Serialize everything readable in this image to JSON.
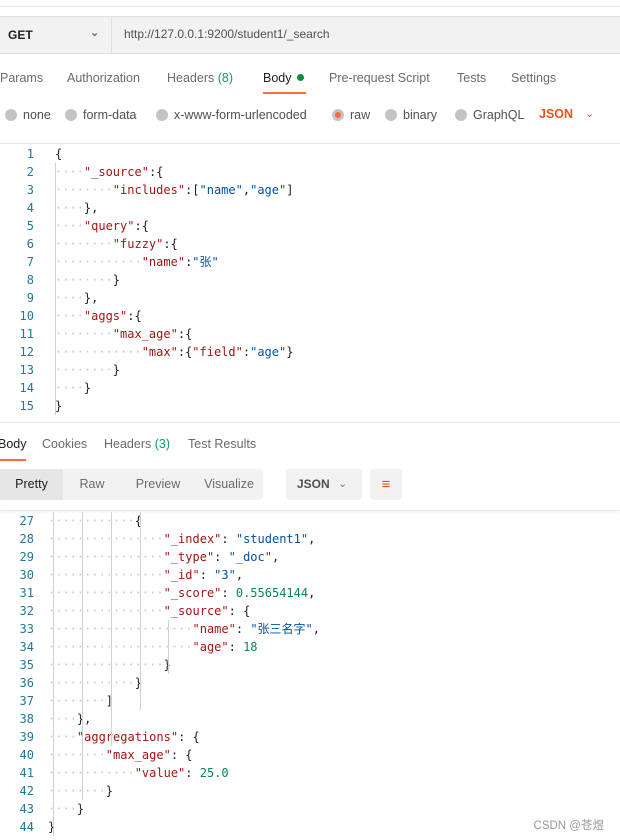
{
  "request": {
    "method": "GET",
    "url": "http://127.0.0.1:9200/student1/_search",
    "tabs": [
      {
        "label": "Params"
      },
      {
        "label": "Authorization"
      },
      {
        "label": "Headers",
        "count": "(8)"
      },
      {
        "label": "Body",
        "active": true
      },
      {
        "label": "Pre-request Script"
      },
      {
        "label": "Tests"
      },
      {
        "label": "Settings"
      }
    ],
    "body_types": [
      {
        "label": "none"
      },
      {
        "label": "form-data"
      },
      {
        "label": "x-www-form-urlencoded"
      },
      {
        "label": "raw",
        "selected": true
      },
      {
        "label": "binary"
      },
      {
        "label": "GraphQL"
      }
    ],
    "raw_format": "JSON",
    "code": [
      {
        "n": "1",
        "i": 0,
        "t": [
          [
            "p",
            "{"
          ]
        ]
      },
      {
        "n": "2",
        "i": 1,
        "t": [
          [
            "k",
            "\"_source\""
          ],
          [
            "p",
            ":{"
          ]
        ]
      },
      {
        "n": "3",
        "i": 2,
        "t": [
          [
            "k",
            "\"includes\""
          ],
          [
            "p",
            ":["
          ],
          [
            "s",
            "\"name\""
          ],
          [
            "p",
            ","
          ],
          [
            "s",
            "\"age\""
          ],
          [
            "p",
            "]"
          ]
        ]
      },
      {
        "n": "4",
        "i": 1,
        "t": [
          [
            "p",
            "},"
          ]
        ]
      },
      {
        "n": "5",
        "i": 1,
        "t": [
          [
            "k",
            "\"query\""
          ],
          [
            "p",
            ":{"
          ]
        ]
      },
      {
        "n": "6",
        "i": 2,
        "t": [
          [
            "k",
            "\"fuzzy\""
          ],
          [
            "p",
            ":{"
          ]
        ]
      },
      {
        "n": "7",
        "i": 3,
        "t": [
          [
            "k",
            "\"name\""
          ],
          [
            "p",
            ":"
          ],
          [
            "s",
            "\"张\""
          ]
        ]
      },
      {
        "n": "8",
        "i": 2,
        "t": [
          [
            "p",
            "}"
          ]
        ]
      },
      {
        "n": "9",
        "i": 1,
        "t": [
          [
            "p",
            "},"
          ]
        ]
      },
      {
        "n": "10",
        "i": 1,
        "t": [
          [
            "k",
            "\"aggs\""
          ],
          [
            "p",
            ":{"
          ]
        ]
      },
      {
        "n": "11",
        "i": 2,
        "t": [
          [
            "k",
            "\"max_age\""
          ],
          [
            "p",
            ":{"
          ]
        ]
      },
      {
        "n": "12",
        "i": 3,
        "t": [
          [
            "k",
            "\"max\""
          ],
          [
            "p",
            ":{"
          ],
          [
            "k",
            "\"field\""
          ],
          [
            "p",
            ":"
          ],
          [
            "s",
            "\"age\""
          ],
          [
            "p",
            "}"
          ]
        ]
      },
      {
        "n": "13",
        "i": 2,
        "t": [
          [
            "p",
            "}"
          ]
        ]
      },
      {
        "n": "14",
        "i": 1,
        "t": [
          [
            "p",
            "}"
          ]
        ]
      },
      {
        "n": "15",
        "i": 0,
        "t": [
          [
            "p",
            "}"
          ]
        ]
      }
    ]
  },
  "response": {
    "tabs": [
      {
        "label": "Body",
        "active": true
      },
      {
        "label": "Cookies"
      },
      {
        "label": "Headers",
        "count": "(3)"
      },
      {
        "label": "Test Results"
      }
    ],
    "views": [
      "Pretty",
      "Raw",
      "Preview",
      "Visualize"
    ],
    "format": "JSON",
    "wrap_icon": "wrap-lines-icon",
    "code": [
      {
        "n": "27",
        "i": 3,
        "t": [
          [
            "p",
            "{"
          ]
        ]
      },
      {
        "n": "28",
        "i": 4,
        "t": [
          [
            "k",
            "\"_index\""
          ],
          [
            "p",
            ": "
          ],
          [
            "s",
            "\"student1\""
          ],
          [
            "p",
            ","
          ]
        ]
      },
      {
        "n": "29",
        "i": 4,
        "t": [
          [
            "k",
            "\"_type\""
          ],
          [
            "p",
            ": "
          ],
          [
            "s",
            "\"_doc\""
          ],
          [
            "p",
            ","
          ]
        ]
      },
      {
        "n": "30",
        "i": 4,
        "t": [
          [
            "k",
            "\"_id\""
          ],
          [
            "p",
            ": "
          ],
          [
            "s",
            "\"3\""
          ],
          [
            "p",
            ","
          ]
        ]
      },
      {
        "n": "31",
        "i": 4,
        "t": [
          [
            "k",
            "\"_score\""
          ],
          [
            "p",
            ": "
          ],
          [
            "n",
            "0.55654144"
          ],
          [
            "p",
            ","
          ]
        ]
      },
      {
        "n": "32",
        "i": 4,
        "t": [
          [
            "k",
            "\"_source\""
          ],
          [
            "p",
            ": {"
          ]
        ]
      },
      {
        "n": "33",
        "i": 5,
        "t": [
          [
            "k",
            "\"name\""
          ],
          [
            "p",
            ": "
          ],
          [
            "s",
            "\"张三名字\""
          ],
          [
            "p",
            ","
          ]
        ]
      },
      {
        "n": "34",
        "i": 5,
        "t": [
          [
            "k",
            "\"age\""
          ],
          [
            "p",
            ": "
          ],
          [
            "n",
            "18"
          ]
        ]
      },
      {
        "n": "35",
        "i": 4,
        "t": [
          [
            "p",
            "}"
          ]
        ]
      },
      {
        "n": "36",
        "i": 3,
        "t": [
          [
            "p",
            "}"
          ]
        ]
      },
      {
        "n": "37",
        "i": 2,
        "t": [
          [
            "p",
            "]"
          ]
        ]
      },
      {
        "n": "38",
        "i": 1,
        "t": [
          [
            "p",
            "},"
          ]
        ]
      },
      {
        "n": "39",
        "i": 1,
        "t": [
          [
            "k",
            "\"aggregations\""
          ],
          [
            "p",
            ": {"
          ]
        ]
      },
      {
        "n": "40",
        "i": 2,
        "t": [
          [
            "k",
            "\"max_age\""
          ],
          [
            "p",
            ": {"
          ]
        ]
      },
      {
        "n": "41",
        "i": 3,
        "t": [
          [
            "k",
            "\"value\""
          ],
          [
            "p",
            ": "
          ],
          [
            "n",
            "25.0"
          ]
        ]
      },
      {
        "n": "42",
        "i": 2,
        "t": [
          [
            "p",
            "}"
          ]
        ]
      },
      {
        "n": "43",
        "i": 1,
        "t": [
          [
            "p",
            "}"
          ]
        ]
      },
      {
        "n": "44",
        "i": 0,
        "t": [
          [
            "p",
            "}"
          ]
        ]
      }
    ]
  },
  "colors": {
    "accent": "#ff6c37",
    "key": "#a31515",
    "string": "#0451a5",
    "number": "#098658",
    "count": "#0f9d58"
  },
  "watermark": "CSDN @苍煜"
}
